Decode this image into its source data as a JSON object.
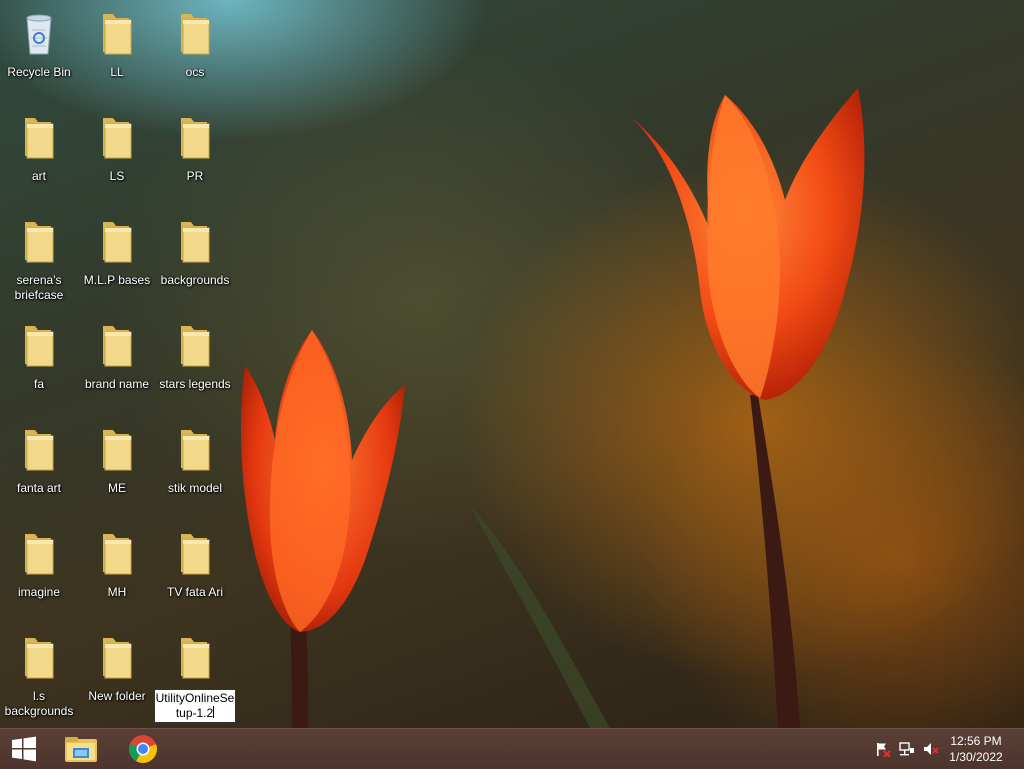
{
  "desktop": {
    "icons": [
      {
        "label": "Recycle Bin",
        "icon": "recycle-bin-icon"
      },
      {
        "label": "LL",
        "icon": "folder-icon"
      },
      {
        "label": "ocs",
        "icon": "folder-icon"
      },
      {
        "label": "art",
        "icon": "folder-icon"
      },
      {
        "label": "LS",
        "icon": "folder-icon"
      },
      {
        "label": "PR",
        "icon": "folder-icon"
      },
      {
        "label": "serena's briefcase",
        "icon": "folder-icon"
      },
      {
        "label": "M.L.P bases",
        "icon": "folder-icon"
      },
      {
        "label": "backgrounds",
        "icon": "folder-icon"
      },
      {
        "label": "fa",
        "icon": "folder-icon"
      },
      {
        "label": "brand name",
        "icon": "folder-icon"
      },
      {
        "label": "stars legends",
        "icon": "folder-icon"
      },
      {
        "label": "fanta art",
        "icon": "folder-icon"
      },
      {
        "label": "ME",
        "icon": "folder-icon"
      },
      {
        "label": "stik  model",
        "icon": "folder-icon"
      },
      {
        "label": "imagine",
        "icon": "folder-icon"
      },
      {
        "label": "MH",
        "icon": "folder-icon"
      },
      {
        "label": "TV  fata Ari",
        "icon": "folder-icon"
      },
      {
        "label": "l.s backgrounds",
        "icon": "folder-icon"
      },
      {
        "label": "New folder",
        "icon": "folder-icon"
      },
      {
        "label": "UtilityOnlineSetup-1.2",
        "icon": "folder-icon",
        "renaming": true
      }
    ]
  },
  "taskbar": {
    "start": "windows-start-icon",
    "pinned": [
      "file-explorer-icon",
      "chrome-icon"
    ],
    "tray": [
      "action-center-flag-icon",
      "network-icon",
      "volume-muted-icon"
    ],
    "clock": {
      "time": "12:56 PM",
      "date": "1/30/2022"
    }
  },
  "colors": {
    "taskbar": "#4d342c",
    "folder": "#f2d98a"
  }
}
